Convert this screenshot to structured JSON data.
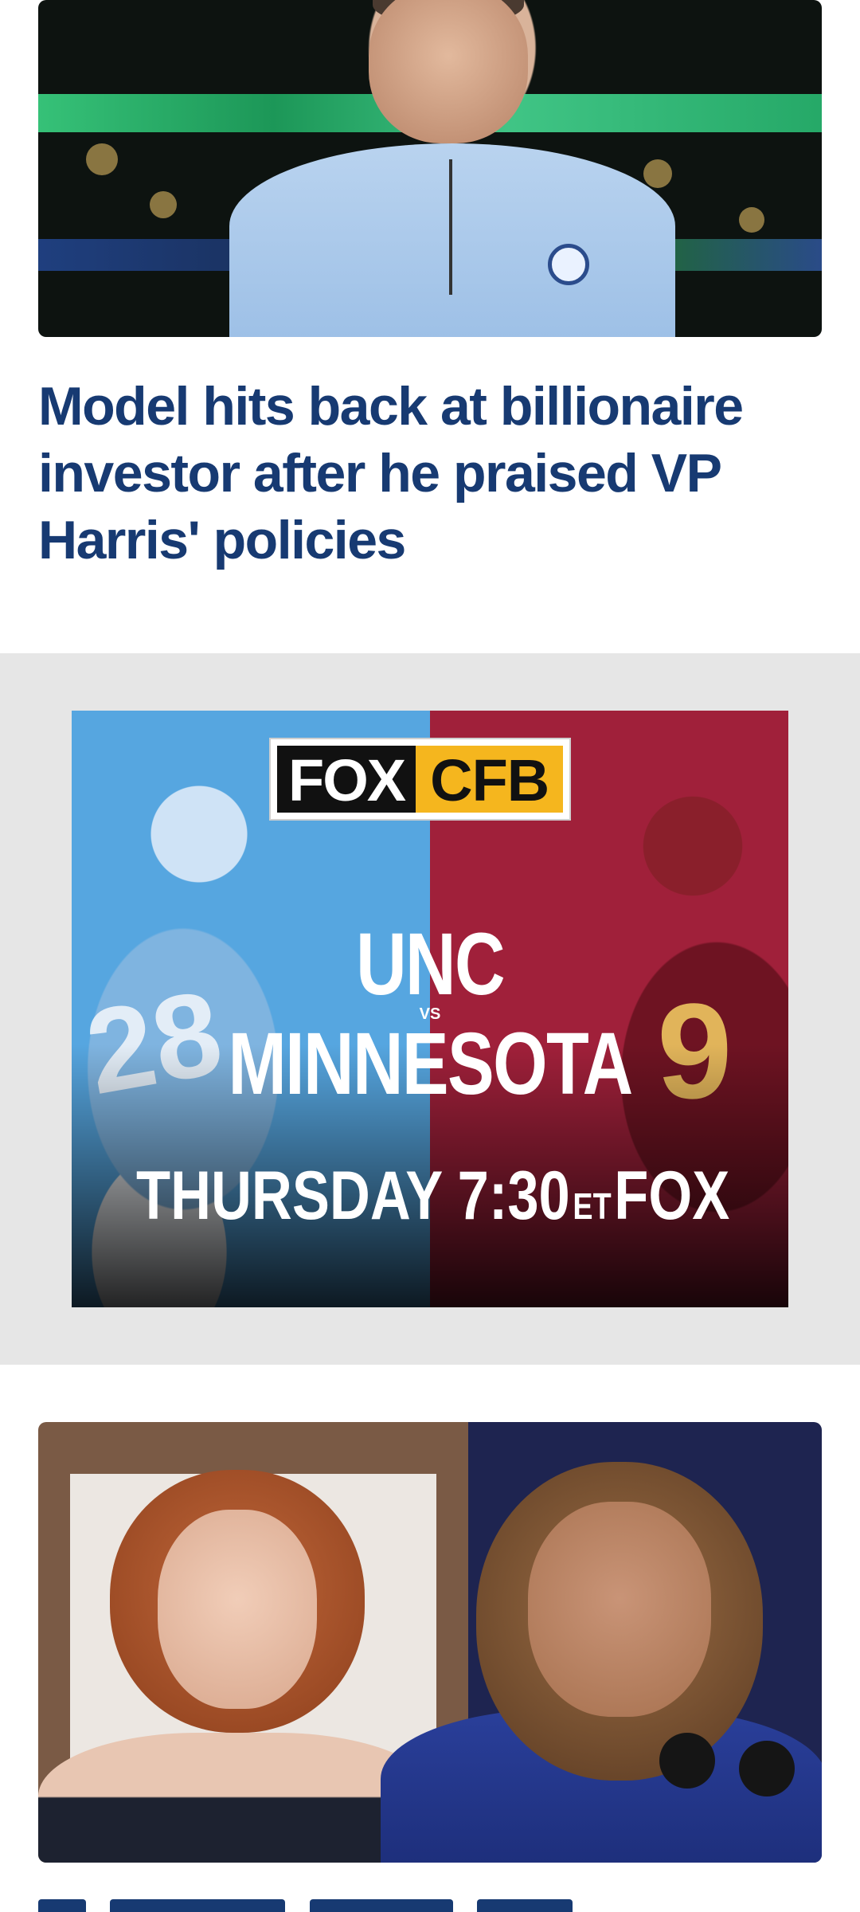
{
  "story1": {
    "image_alt": "Man in light blue quarter-zip at basketball arena",
    "headline": "Model hits back at billionaire investor after he praised VP Harris' policies"
  },
  "ad": {
    "logo_left": "FOX",
    "logo_right": "CFB",
    "team_home": "UNC",
    "vs": "VS",
    "team_away": "MINNESOTA",
    "day_time": "THURSDAY 7:30",
    "timezone": "ET",
    "network": "FOX",
    "jersey_left": "28",
    "jersey_right": "9",
    "colors": {
      "left": "#56a6e0",
      "right": "#a0203a",
      "logo_accent": "#f5b61e"
    }
  },
  "story2": {
    "image_alt": "Two women side by side, one with red hair and one smiling at podium"
  },
  "colors": {
    "headline": "#173a72",
    "ad_background": "#e6e6e6"
  }
}
